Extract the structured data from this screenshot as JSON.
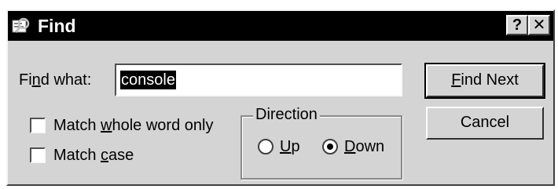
{
  "window": {
    "title": "Find",
    "help_button": "?",
    "close_button": "✕"
  },
  "find_what": {
    "label_pre": "Fi",
    "label_key": "n",
    "label_post": "d what:",
    "value": "console"
  },
  "options": {
    "whole_word": {
      "pre": "Match ",
      "key": "w",
      "post": "hole word only",
      "checked": false
    },
    "match_case": {
      "pre": "Match ",
      "key": "c",
      "post": "ase",
      "checked": false
    }
  },
  "direction": {
    "title": "Direction",
    "up": {
      "key": "U",
      "post": "p",
      "selected": false
    },
    "down": {
      "key": "D",
      "post": "own",
      "selected": true
    }
  },
  "buttons": {
    "find_next": {
      "key": "F",
      "post": "ind Next"
    },
    "cancel": "Cancel"
  },
  "colors": {
    "titlebar": "#000000",
    "dialog_face": "#d4d4d4"
  }
}
